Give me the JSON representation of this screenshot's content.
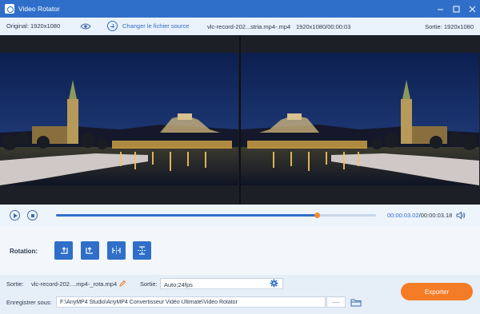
{
  "window": {
    "title": "Video Rotator",
    "controls": [
      "minimize-icon",
      "maximize-icon",
      "close-icon"
    ]
  },
  "infobar": {
    "original": "Original: 1920x1080",
    "change_source": "Changer le fichier source",
    "file_name": "vlc-record-202...stria.mp4-.mp4",
    "file_res_time": "1920x1080/00:00:03",
    "sortie": "Sortie: 1920x1080"
  },
  "player": {
    "progress": 0.815,
    "current_time": "00:00:03.02",
    "separator": "/",
    "total_time": "00:00:03.18"
  },
  "rotation": {
    "label": "Rotation:",
    "buttons": [
      "rotate-left-icon",
      "rotate-right-icon",
      "flip-horizontal-icon",
      "flip-vertical-icon"
    ]
  },
  "output": {
    "sortie_label": "Sortie:",
    "sortie_file": "vlc-record-202....mp4-_rota.mp4",
    "format_label": "Sortie:",
    "format_value": "Auto;24fps",
    "save_label": "Enregistrer sous:",
    "save_path": "F:\\AnyMP4 Studio\\AnyMP4 Convertisseur Vidéo Ultimate\\Video Rotator",
    "browse_label": "···",
    "export_label": "Exporter"
  },
  "colors": {
    "accent": "#2f6fc9",
    "export": "#f47c26",
    "thumb": "#f38a2b"
  }
}
